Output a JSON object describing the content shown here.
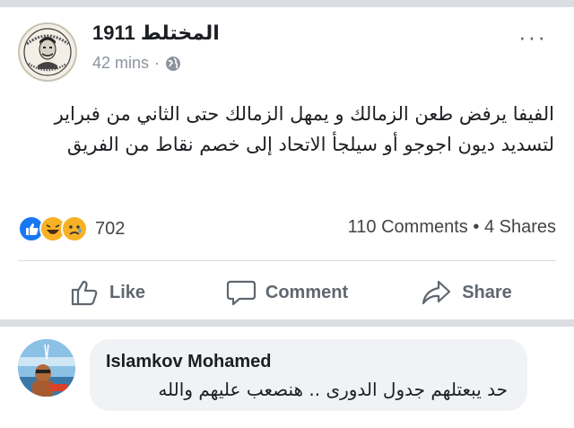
{
  "post": {
    "page_name": "المختلط 1911",
    "time": "42 mins",
    "dot": "·",
    "visibility_icon": "globe-icon",
    "more_icon": "more-horizontal-icon",
    "more_label": "···",
    "text": "الفيفا يرفض طعن الزمالك و يمهل الزمالك حتى الثاني من فبراير لتسديد ديون اجوجو أو سيلجأ الاتحاد إلى خصم نقاط من الفريق",
    "avatar_icon": "page-logo-icon"
  },
  "stats": {
    "reactions": [
      "like-reaction-icon",
      "haha-reaction-icon",
      "sad-reaction-icon"
    ],
    "reaction_count": "702",
    "comments": "110 Comments",
    "separator": "•",
    "shares": "4 Shares"
  },
  "actions": [
    {
      "label": "Like",
      "icon": "thumbs-up-icon"
    },
    {
      "label": "Comment",
      "icon": "comment-icon"
    },
    {
      "label": "Share",
      "icon": "share-arrow-icon"
    }
  ],
  "comment": {
    "author": "Islamkov Mohamed",
    "text": "حد يبعتلهم جدول الدورى .. هنصعب عليهم والله"
  },
  "colors": {
    "brand_blue": "#1877f2",
    "reaction_yellow": "#f7b125",
    "muted_text": "#606770",
    "divider": "#dadde1",
    "bubble_bg": "#f0f2f5"
  }
}
